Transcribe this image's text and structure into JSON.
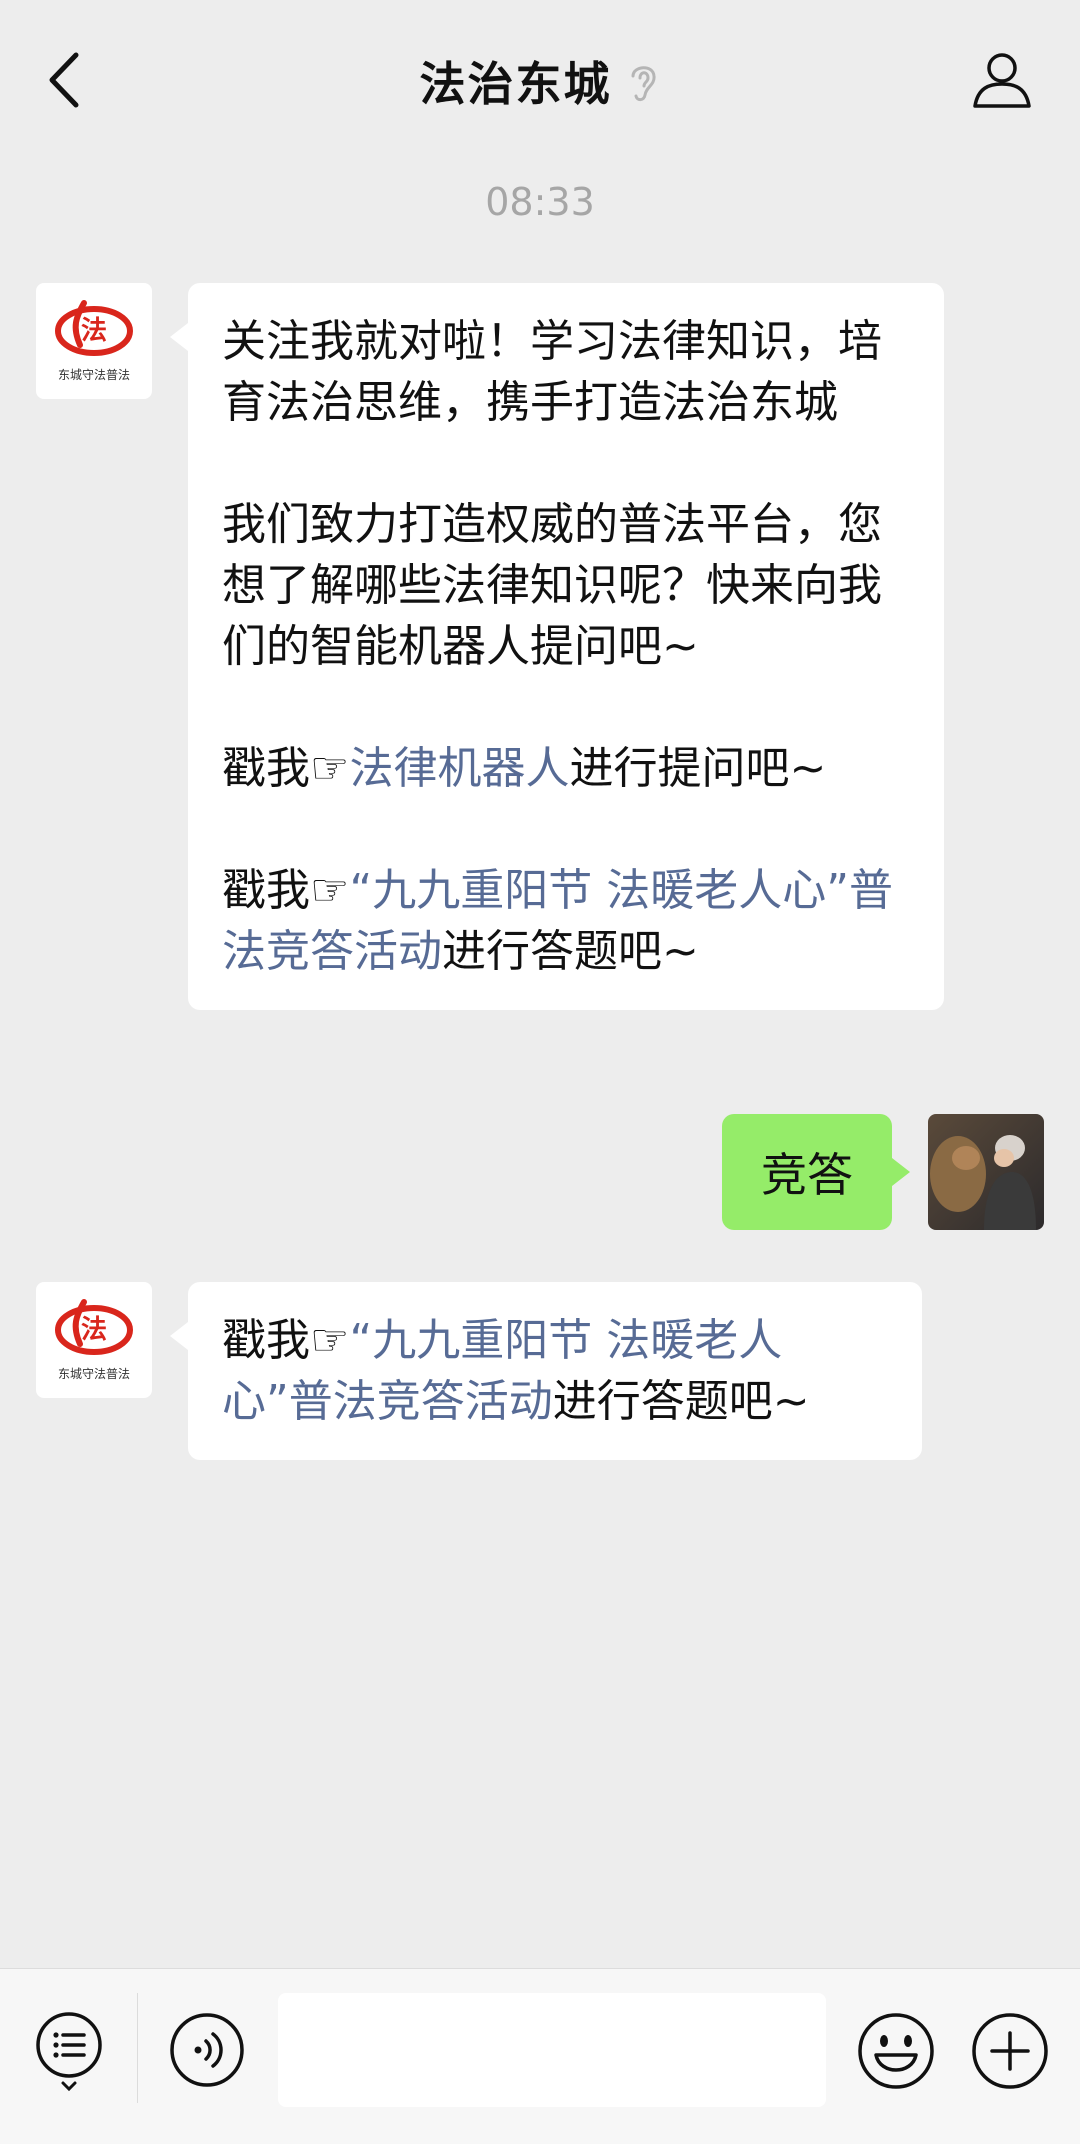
{
  "header": {
    "title": "法治东城",
    "back_icon": "chevron-left-icon",
    "ear_icon": "ear-icon",
    "profile_icon": "person-icon"
  },
  "chat": {
    "timestamp": "08:33",
    "messages": [
      {
        "sender": "法治东城",
        "avatar_text": "东城守法普法",
        "paragraphs": {
          "p1": "关注我就对啦！学习法律知识，培育法治思维，携手打造法治东城",
          "p2": "我们致力打造权威的普法平台，您想了解哪些法律知识呢？快来向我们的智能机器人提问吧~",
          "p3_prefix": "戳我☞",
          "p3_link": "法律机器人",
          "p3_suffix": "进行提问吧~",
          "p4_prefix": "戳我☞",
          "p4_link": "“九九重阳节 法暖老人心”普法竞答活动",
          "p4_suffix": "进行答题吧~"
        }
      },
      {
        "sender": "me",
        "text": "竞答"
      },
      {
        "sender": "法治东城",
        "avatar_text": "东城守法普法",
        "prefix": "戳我☞",
        "link": "“九九重阳节 法暖老人心”普法竞答活动",
        "suffix": "进行答题吧~"
      }
    ]
  },
  "input_bar": {
    "menu_icon": "list-menu-icon",
    "voice_icon": "voice-icon",
    "input_value": "",
    "emoji_icon": "smiley-icon",
    "plus_icon": "plus-icon"
  },
  "colors": {
    "background": "#ededed",
    "bubble_me": "#95ec69",
    "link": "#576b95",
    "logo_red": "#d9261c"
  }
}
